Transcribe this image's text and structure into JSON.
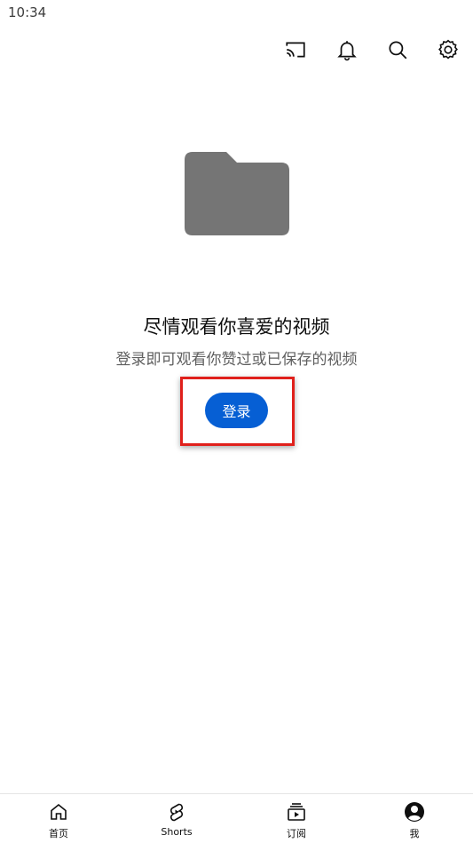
{
  "status_bar": {
    "time": "10:34"
  },
  "top_bar": {
    "icons": [
      "cast-icon",
      "notifications-bell-icon",
      "search-icon",
      "settings-gear-icon"
    ]
  },
  "empty_state": {
    "icon": "folder-icon",
    "title": "尽情观看你喜爱的视频",
    "subtitle": "登录即可观看你赞过或已保存的视频",
    "button_label": "登录"
  },
  "bottom_nav": {
    "items": [
      {
        "label": "首页",
        "icon": "home-icon"
      },
      {
        "label": "Shorts",
        "icon": "shorts-icon"
      },
      {
        "label": "订阅",
        "icon": "subscriptions-icon"
      },
      {
        "label": "我",
        "icon": "account-icon"
      }
    ]
  },
  "colors": {
    "accent": "#065fd4",
    "highlight": "#e0201b",
    "folder": "#757575"
  }
}
